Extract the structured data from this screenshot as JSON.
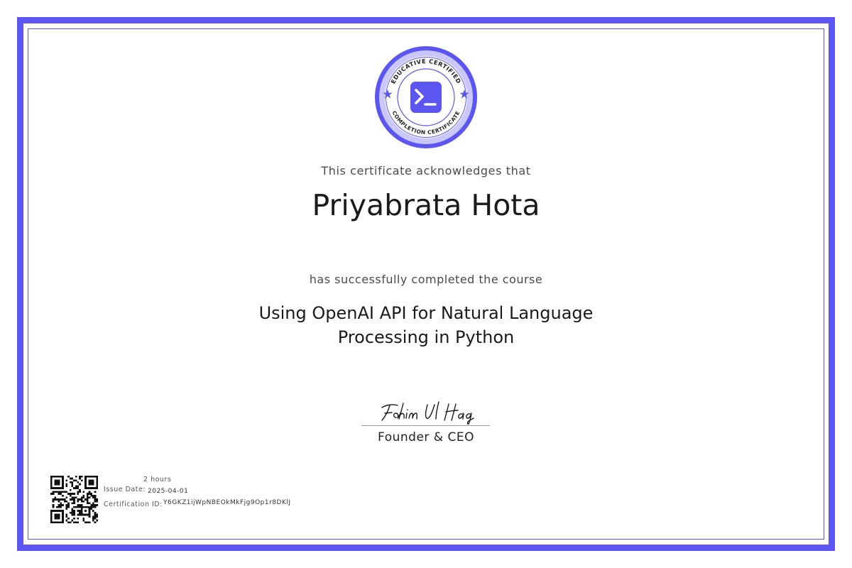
{
  "seal": {
    "top_text": "EDUCATIVE CERTIFIED",
    "bottom_text": "COMPLETION CERTIFICATE",
    "center_icon": "terminal-prompt-icon",
    "star_icon": "star-icon"
  },
  "certificate": {
    "acknowledgement": "This certificate acknowledges that",
    "recipient_name": "Priyabrata Hota",
    "completion_text": "has successfully completed the course",
    "course_title_line1": "Using OpenAI API for Natural Language",
    "course_title_line2": "Processing in Python"
  },
  "signature": {
    "name": "Fahim Ul Haq",
    "title": "Founder & CEO"
  },
  "details": {
    "duration": "2 hours",
    "issue_date_label": "Issue Date:",
    "issue_date": "2025-04-01",
    "cert_id_label": "Certification ID:",
    "cert_id": "Y6GKZ1ijWpNBEOkMkFjg9Op1r8DKlJ"
  },
  "colors": {
    "accent": "#5b56f2",
    "accent_light": "#c9c7fb"
  }
}
